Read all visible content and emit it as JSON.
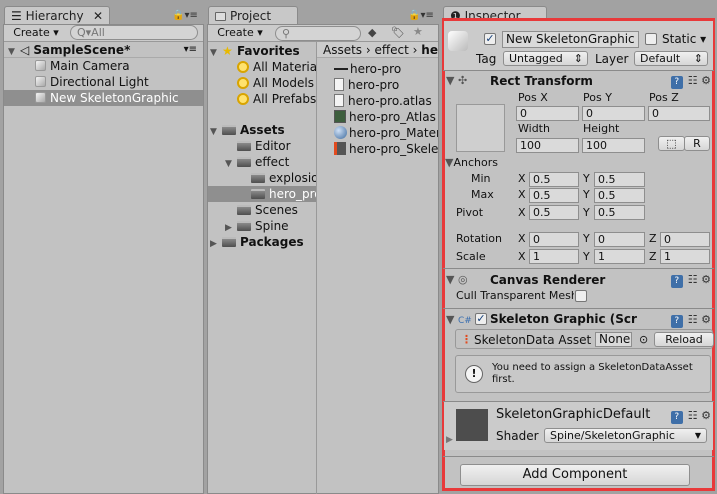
{
  "hierarchy": {
    "tab": "Hierarchy",
    "create": "Create ▾",
    "search": "Q▾All",
    "scene": "SampleScene*",
    "items": [
      "Main Camera",
      "Directional Light",
      "New SkeletonGraphic"
    ]
  },
  "project": {
    "tab": "Project",
    "create": "Create ▾",
    "favorites": "Favorites",
    "fav_items": [
      "All Materials",
      "All Models",
      "All Prefabs"
    ],
    "assets": "Assets",
    "folders": [
      "Editor",
      "effect",
      "explosion",
      "hero_pro",
      "Scenes",
      "Spine"
    ],
    "packages": "Packages",
    "breadcrumb": [
      "Assets",
      "effect",
      "hero_pro"
    ],
    "files": [
      "hero-pro",
      "hero-pro",
      "hero-pro.atlas",
      "hero-pro_Atlas",
      "hero-pro_Material",
      "hero-pro_SkeletonData"
    ]
  },
  "inspector": {
    "tab": "Inspector",
    "name": "New SkeletonGraphic",
    "static": "Static",
    "tag_label": "Tag",
    "tag": "Untagged",
    "layer_label": "Layer",
    "layer": "Default",
    "rect": {
      "title": "Rect Transform",
      "posx": "Pos X",
      "posy": "Pos Y",
      "posz": "Pos Z",
      "px": "0",
      "py": "0",
      "pz": "0",
      "width_label": "Width",
      "height_label": "Height",
      "width": "100",
      "height": "100",
      "r": "R",
      "anchors": "Anchors",
      "min": "Min",
      "max": "Max",
      "pivot": "Pivot",
      "min_x": "0.5",
      "min_y": "0.5",
      "max_x": "0.5",
      "max_y": "0.5",
      "pivot_x": "0.5",
      "pivot_y": "0.5",
      "rotation": "Rotation",
      "scale": "Scale",
      "rx": "0",
      "ry": "0",
      "rz": "0",
      "sx": "1",
      "sy": "1",
      "sz": "1",
      "X": "X",
      "Y": "Y",
      "Z": "Z"
    },
    "canvas": {
      "title": "Canvas Renderer",
      "cull": "Cull Transparent Mesh"
    },
    "skel": {
      "title": "Skeleton Graphic (Script)",
      "asset_label": "SkeletonData Asset",
      "asset": "None",
      "reload": "Reload",
      "warning": "You need to assign a SkeletonDataAsset first."
    },
    "material": {
      "name": "SkeletonGraphicDefault",
      "shader_label": "Shader",
      "shader": "Spine/SkeletonGraphic"
    },
    "add": "Add Component"
  },
  "colors": {
    "highlight": "#e8393a",
    "selected": "#8f8f8f"
  }
}
